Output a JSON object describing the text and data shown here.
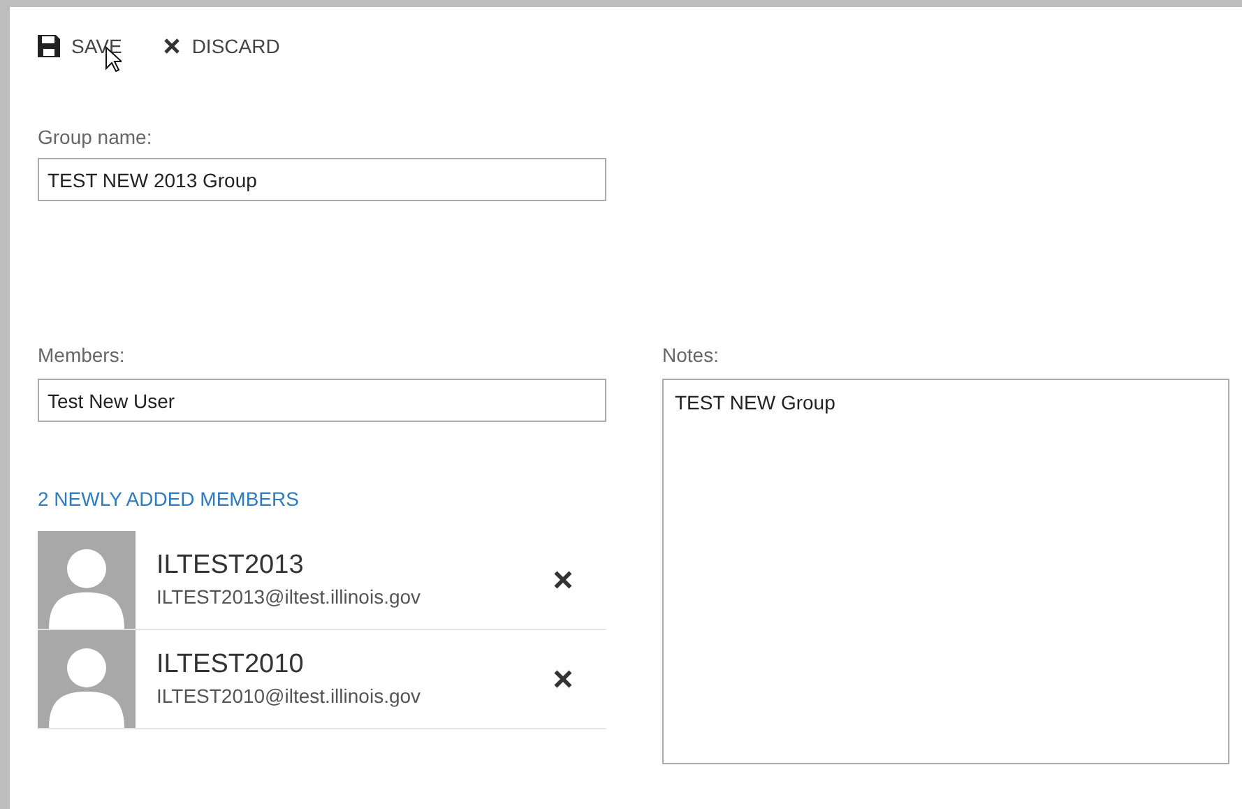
{
  "toolbar": [
    {
      "label": "SAVE",
      "kind": "save"
    },
    {
      "label": "DISCARD",
      "kind": "discard"
    }
  ],
  "group_name": {
    "label": "Group name:",
    "value": "TEST NEW 2013 Group"
  },
  "members": {
    "label": "Members:",
    "value": "Test New User"
  },
  "notes": {
    "label": "Notes:",
    "value": "TEST NEW Group"
  },
  "added_heading": "2 NEWLY ADDED MEMBERS",
  "added_members": [
    {
      "name": "ILTEST2013",
      "email": "ILTEST2013@iltest.illinois.gov"
    },
    {
      "name": "ILTEST2010",
      "email": "ILTEST2010@iltest.illinois.gov"
    }
  ]
}
